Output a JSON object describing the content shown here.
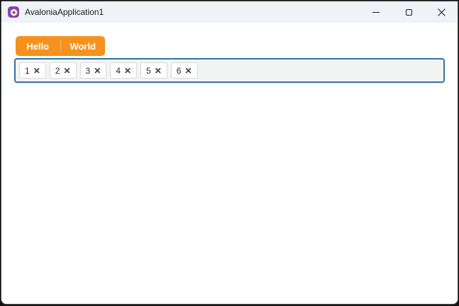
{
  "window": {
    "title": "AvaloniaApplication1"
  },
  "titlebar": {
    "icons": {
      "logo": "avalonia-logo",
      "minimize": "─",
      "maximize": "▢",
      "close": "✕"
    }
  },
  "tabs": [
    {
      "label": "Hello"
    },
    {
      "label": "World"
    }
  ],
  "chip_input": {
    "remove_icon": "✕",
    "chips": [
      {
        "label": "1"
      },
      {
        "label": "2"
      },
      {
        "label": "3"
      },
      {
        "label": "4"
      },
      {
        "label": "5"
      },
      {
        "label": "6"
      }
    ]
  },
  "colors": {
    "accent_orange": "#F7911D",
    "focus_border": "#2E74A8",
    "logo_purple": "#8B44AC",
    "titlebar_bg": "#EFF3F8"
  }
}
